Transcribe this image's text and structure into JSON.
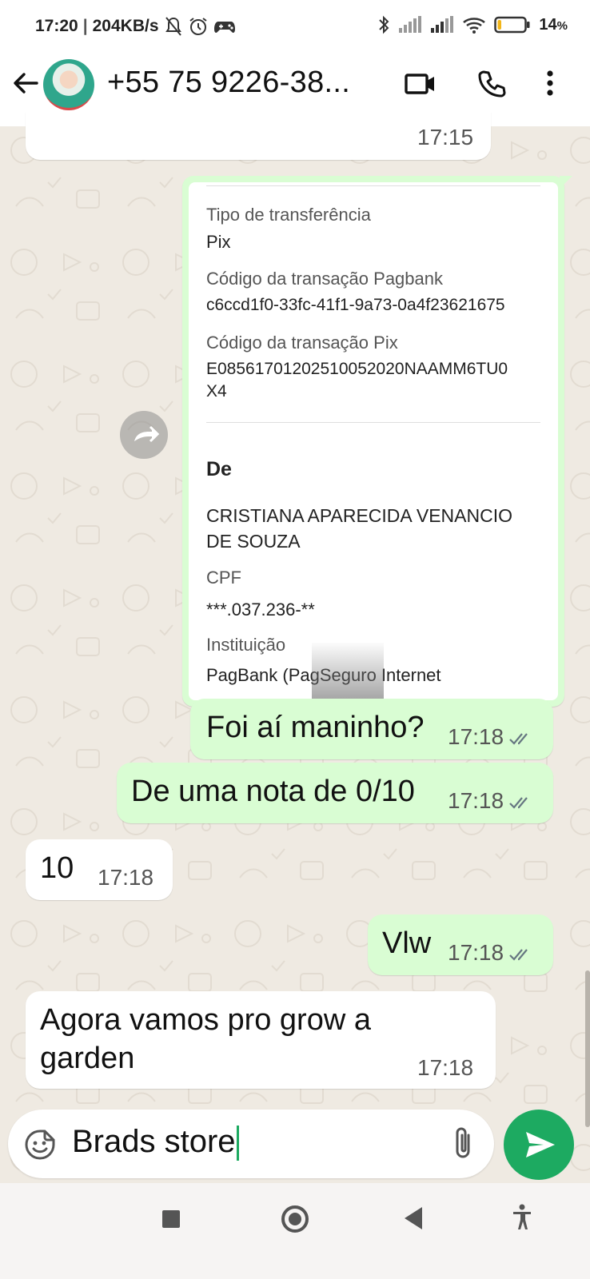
{
  "status_bar": {
    "time": "17:20",
    "network_speed": "204KB/s",
    "battery": "14",
    "battery_unit": "%",
    "battery_level": 0.14,
    "icons": [
      "bell-off-icon",
      "alarm-icon",
      "game-icon",
      "bluetooth-icon",
      "signal-icon",
      "signal-icon",
      "wifi-icon",
      "battery-icon"
    ]
  },
  "header": {
    "contact_name": "+55 75 9226-38...",
    "icons": [
      "back-arrow-icon",
      "video-call-icon",
      "phone-icon",
      "more-vert-icon"
    ]
  },
  "messages": {
    "prev_in": {
      "time": "17:15"
    },
    "receipt": {
      "label_tipo": "Tipo de transferência",
      "value_tipo": "Pix",
      "label_pagbank": "Código da transação Pagbank",
      "value_pagbank": "c6ccd1f0-33fc-41f1-9a73-0a4f23621675",
      "label_pix": "Código da transação Pix",
      "value_pix_1": "E08561701202510052020NAAMM6TU0",
      "value_pix_2": "X4",
      "heading_de": "De",
      "name_1": "CRISTIANA APARECIDA VENANCIO",
      "name_2": "DE SOUZA",
      "label_cpf": "CPF",
      "value_cpf": "***.037.236-**",
      "label_inst": "Instituição",
      "value_inst": "PagBank (PagSeguro Internet"
    },
    "m1": {
      "text": "Foi aí maninho?",
      "time": "17:18"
    },
    "m2": {
      "text": "De uma nota de 0/10",
      "time": "17:18"
    },
    "m3": {
      "text": "10",
      "time": "17:18"
    },
    "m4": {
      "text": "Vlw",
      "time": "17:18"
    },
    "m5": {
      "text_1": "Agora vamos pro grow a",
      "text_2": "garden",
      "time": "17:18"
    }
  },
  "composer": {
    "text": "Brads store",
    "icons": [
      "emoji-sticker-icon",
      "attach-icon",
      "send-icon"
    ]
  },
  "colors": {
    "outgoing_bubble": "#d9fdd3",
    "incoming_bubble": "#ffffff",
    "chat_background": "#efeae2",
    "accent": "#1daa61",
    "read_ticks": "#667781"
  }
}
